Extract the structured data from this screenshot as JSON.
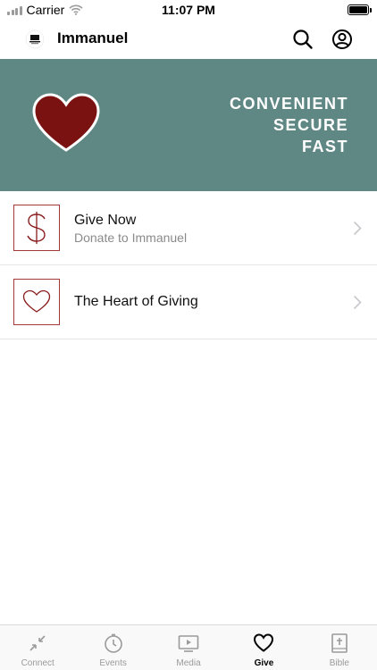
{
  "status_bar": {
    "carrier": "Carrier",
    "time": "11:07 PM"
  },
  "nav": {
    "title": "Immanuel",
    "logo_icon": "church-logo-icon",
    "search_icon": "search-icon",
    "profile_icon": "profile-icon"
  },
  "banner": {
    "lines": [
      "CONVENIENT",
      "SECURE",
      "FAST"
    ],
    "background_color": "#5f8885",
    "heart_color": "#7a1212"
  },
  "list": {
    "items": [
      {
        "title": "Give Now",
        "subtitle": "Donate to Immanuel",
        "icon": "dollar-icon"
      },
      {
        "title": "The Heart of Giving",
        "subtitle": "",
        "icon": "heart-outline-icon"
      }
    ]
  },
  "tab_bar": {
    "active": "Give",
    "tabs": [
      {
        "label": "Connect",
        "icon": "connect-icon"
      },
      {
        "label": "Events",
        "icon": "clock-icon"
      },
      {
        "label": "Media",
        "icon": "play-icon"
      },
      {
        "label": "Give",
        "icon": "heart-icon"
      },
      {
        "label": "Bible",
        "icon": "bible-icon"
      }
    ]
  },
  "colors": {
    "accent": "#a33a3a",
    "inactive_tab": "#9a9a9a"
  }
}
